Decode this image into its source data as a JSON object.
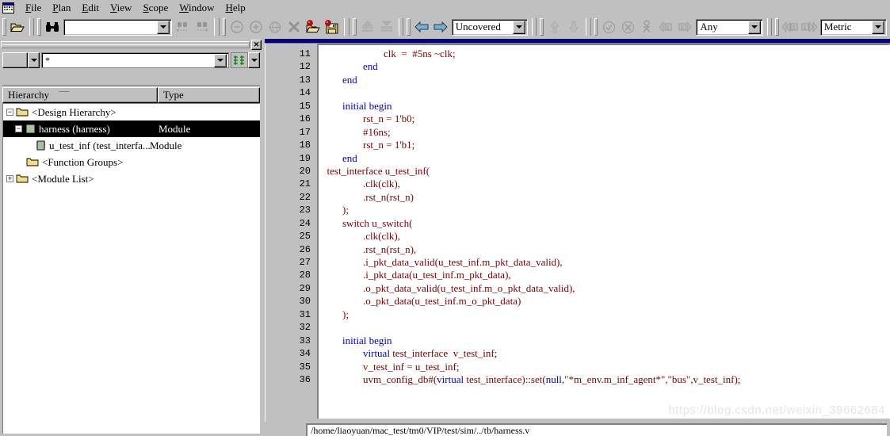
{
  "app": {
    "icon_name": "coverage-app-icon"
  },
  "menubar": {
    "items": [
      {
        "label": "File",
        "accel": "F"
      },
      {
        "label": "Plan",
        "accel": "P"
      },
      {
        "label": "Edit",
        "accel": "E"
      },
      {
        "label": "View",
        "accel": "V"
      },
      {
        "label": "Scope",
        "accel": "S"
      },
      {
        "label": "Window",
        "accel": "W"
      },
      {
        "label": "Help",
        "accel": "H"
      }
    ]
  },
  "toolbar": {
    "open_button": "open-folder-icon",
    "find_button": "binoculars-icon",
    "find_input_value": "",
    "find_input_placeholder": "",
    "find_prev": "find-previous-icon",
    "find_next": "find-next-icon",
    "zoom_out": "zoom-out-icon",
    "zoom_in": "zoom-in-icon",
    "globe": "globe-icon",
    "delete": "delete-x-icon",
    "load_test": "load-test-icon",
    "save_test": "save-test-icon",
    "merge_up": "merge-up-icon",
    "merge_down": "merge-down-icon",
    "back": "back-arrow-icon",
    "forward": "forward-arrow-icon",
    "view_mode": "Uncovered",
    "annotate_up": "annotate-up-icon",
    "annotate_down": "annotate-down-icon",
    "check_ok": "check-circle-icon",
    "check_fail": "cancel-circle-icon",
    "exclude": "exclude-icon",
    "prev_exclusion": "prev-exclusion-icon",
    "next_exclusion": "next-exclusion-icon",
    "filter_type": "Any",
    "prev_metric": "prev-metric-icon",
    "next_metric": "next-metric-icon",
    "metric_mode": "Metric"
  },
  "left_dock": {
    "close_label": "✕",
    "filter_scope_value": "",
    "filter_value": "*",
    "sort_icon": "sort-toggle-icon",
    "tree": {
      "columns": [
        "Hierarchy",
        "Type"
      ],
      "rows": [
        {
          "label": "<Design Hierarchy>",
          "type": "",
          "depth": 0,
          "icon": "folder",
          "expander": "-",
          "selected": false
        },
        {
          "label": "harness (harness)",
          "type": "Module",
          "depth": 1,
          "icon": "module",
          "expander": "-",
          "selected": true
        },
        {
          "label": "u_test_inf (test_interfa...",
          "type": "Module",
          "depth": 2,
          "icon": "interface",
          "expander": "",
          "selected": false
        },
        {
          "label": "<Function Groups>",
          "type": "",
          "depth": 0,
          "icon": "folder",
          "expander": "",
          "selected": false
        },
        {
          "label": "<Module List>",
          "type": "",
          "depth": 0,
          "icon": "folder",
          "expander": "+",
          "selected": false
        }
      ]
    }
  },
  "code_view": {
    "first_line_number": 11,
    "lines": [
      {
        "n": 11,
        "segments": [
          {
            "t": "                        clk  =  #5ns ~clk;",
            "c": "cd"
          }
        ]
      },
      {
        "n": 12,
        "segments": [
          {
            "t": "                ",
            "c": "cd"
          },
          {
            "t": "end",
            "c": "kw"
          }
        ]
      },
      {
        "n": 13,
        "segments": [
          {
            "t": "        ",
            "c": "cd"
          },
          {
            "t": "end",
            "c": "kw"
          }
        ]
      },
      {
        "n": 14,
        "segments": [
          {
            "t": "",
            "c": "cd"
          }
        ]
      },
      {
        "n": 15,
        "segments": [
          {
            "t": "        ",
            "c": "cd"
          },
          {
            "t": "initial begin",
            "c": "kw"
          }
        ]
      },
      {
        "n": 16,
        "segments": [
          {
            "t": "                rst_n = 1'b0;",
            "c": "cd"
          }
        ]
      },
      {
        "n": 17,
        "segments": [
          {
            "t": "                #16ns;",
            "c": "cd"
          }
        ]
      },
      {
        "n": 18,
        "segments": [
          {
            "t": "                rst_n = 1'b1;",
            "c": "cd"
          }
        ]
      },
      {
        "n": 19,
        "segments": [
          {
            "t": "        ",
            "c": "cd"
          },
          {
            "t": "end",
            "c": "kw"
          }
        ]
      },
      {
        "n": 20,
        "segments": [
          {
            "t": "  test_interface u_test_inf(",
            "c": "cd"
          }
        ]
      },
      {
        "n": 21,
        "segments": [
          {
            "t": "                .clk(clk),",
            "c": "cd"
          }
        ]
      },
      {
        "n": 22,
        "segments": [
          {
            "t": "                .rst_n(rst_n)",
            "c": "cd"
          }
        ]
      },
      {
        "n": 23,
        "segments": [
          {
            "t": "        );",
            "c": "cd"
          }
        ]
      },
      {
        "n": 24,
        "segments": [
          {
            "t": "        switch u_switch(",
            "c": "cd"
          }
        ]
      },
      {
        "n": 25,
        "segments": [
          {
            "t": "                .clk(clk),",
            "c": "cd"
          }
        ]
      },
      {
        "n": 26,
        "segments": [
          {
            "t": "                .rst_n(rst_n),",
            "c": "cd"
          }
        ]
      },
      {
        "n": 27,
        "segments": [
          {
            "t": "                .i_pkt_data_valid(u_test_inf.m_pkt_data_valid),",
            "c": "cd"
          }
        ]
      },
      {
        "n": 28,
        "segments": [
          {
            "t": "                .i_pkt_data(u_test_inf.m_pkt_data),",
            "c": "cd"
          }
        ]
      },
      {
        "n": 29,
        "segments": [
          {
            "t": "                .o_pkt_data_valid(u_test_inf.m_o_pkt_data_valid),",
            "c": "cd"
          }
        ]
      },
      {
        "n": 30,
        "segments": [
          {
            "t": "                .o_pkt_data(u_test_inf.m_o_pkt_data)",
            "c": "cd"
          }
        ]
      },
      {
        "n": 31,
        "segments": [
          {
            "t": "        );",
            "c": "cd"
          }
        ]
      },
      {
        "n": 32,
        "segments": [
          {
            "t": "",
            "c": "cd"
          }
        ]
      },
      {
        "n": 33,
        "segments": [
          {
            "t": "        ",
            "c": "cd"
          },
          {
            "t": "initial begin",
            "c": "kw"
          }
        ]
      },
      {
        "n": 34,
        "segments": [
          {
            "t": "                ",
            "c": "cd"
          },
          {
            "t": "virtual",
            "c": "kw"
          },
          {
            "t": " test_interface  v_test_inf;",
            "c": "cd"
          }
        ]
      },
      {
        "n": 35,
        "segments": [
          {
            "t": "                v_test_inf = u_test_inf;",
            "c": "cd"
          }
        ]
      },
      {
        "n": 36,
        "segments": [
          {
            "t": "                uvm_config_db#(",
            "c": "cd"
          },
          {
            "t": "virtual",
            "c": "kw"
          },
          {
            "t": " test_interface)::set(",
            "c": "cd"
          },
          {
            "t": "null",
            "c": "kw"
          },
          {
            "t": ",\"*m_env.m_inf_agent*\",\"bus\",v_test_inf);",
            "c": "cd"
          }
        ]
      }
    ]
  },
  "status_bar": {
    "path": "/home/liaoyuan/mac_test/tm0/VIP/test/sim/../tb/harness.v"
  },
  "watermark": {
    "text": "https://blog.csdn.net/weixin_39662684"
  },
  "colors": {
    "chrome": "#c0c0c0",
    "titlebar": "#000080",
    "keyword": "#0000cd",
    "code": "#800000",
    "selection": "#000000"
  }
}
